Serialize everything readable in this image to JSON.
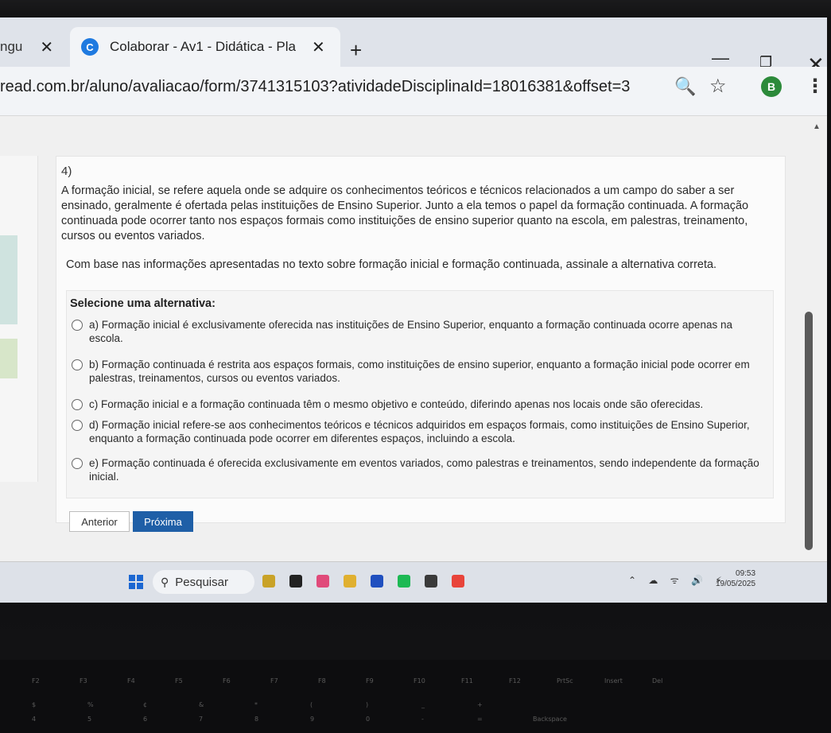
{
  "browser": {
    "tabs": [
      {
        "title": "ngu",
        "active": false
      },
      {
        "title": "Colaborar - Av1 - Didática - Pla",
        "active": true,
        "favicon_letter": "C"
      }
    ],
    "new_tab_symbol": "+",
    "url": "read.com.br/aluno/avaliacao/form/3741315103?atividadeDisciplinaId=18016381&offset=3",
    "profile_letter": "B",
    "close_symbol": "✕",
    "minimize_symbol": "—",
    "maximize_symbol": "❐",
    "menu_symbol": "⋮",
    "zoom_symbol": "🔍",
    "star_symbol": "☆"
  },
  "question": {
    "number": "4)",
    "statement": "A formação inicial, se refere aquela onde se adquire os conhecimentos teóricos e técnicos relacionados a um campo do saber a ser ensinado, geralmente é ofertada pelas instituições de Ensino Superior. Junto a ela temos o papel da formação continuada. A formação continuada pode ocorrer tanto nos espaços formais como instituições de ensino superior quanto na escola, em palestras, treinamento, cursos ou eventos variados.",
    "prompt": "Com base nas informações apresentadas no texto sobre formação inicial e formação continuada, assinale a alternativa correta.",
    "select_label": "Selecione uma alternativa:",
    "options": [
      {
        "text": "a) Formação inicial é exclusivamente oferecida nas instituições de Ensino Superior, enquanto a formação continuada ocorre apenas na escola."
      },
      {
        "text": "b) Formação continuada é restrita aos espaços formais, como instituições de ensino superior, enquanto a formação inicial pode ocorrer em palestras, treinamentos, cursos ou eventos variados."
      },
      {
        "text": "c) Formação inicial e a formação continuada têm o mesmo objetivo e conteúdo, diferindo apenas nos locais onde são oferecidas."
      },
      {
        "text": "d) Formação inicial refere-se aos conhecimentos teóricos e técnicos adquiridos em espaços formais, como instituições de Ensino Superior, enquanto a formação continuada pode ocorrer em diferentes espaços, incluindo a escola."
      },
      {
        "text": "e) Formação continuada é oferecida exclusivamente em eventos variados, como palestras e treinamentos, sendo independente da formação inicial."
      }
    ],
    "prev_label": "Anterior",
    "next_label": "Próxima"
  },
  "taskbar": {
    "search_placeholder": "Pesquisar",
    "time": "09:53",
    "date": "19/05/2025",
    "app_colors": [
      "#c9a227",
      "#222222",
      "#e04a7a",
      "#e0b030",
      "#1f4fbf",
      "#1db954",
      "#3a3a3a",
      "#e8443a"
    ]
  },
  "keyboard": {
    "top_row": [
      "F2",
      "F3",
      "F4",
      "F5",
      "F6",
      "F7",
      "F8",
      "F9",
      "F10",
      "F11",
      "F12",
      "PrtSc",
      "Insert",
      "Del"
    ],
    "number_row": [
      "$",
      "%",
      "¢",
      "&",
      "*",
      "(",
      ")",
      "_",
      "+"
    ],
    "digit_row": [
      "4",
      "5",
      "6",
      "7",
      "8",
      "9",
      "0",
      "-",
      "=",
      "Backspace"
    ]
  }
}
